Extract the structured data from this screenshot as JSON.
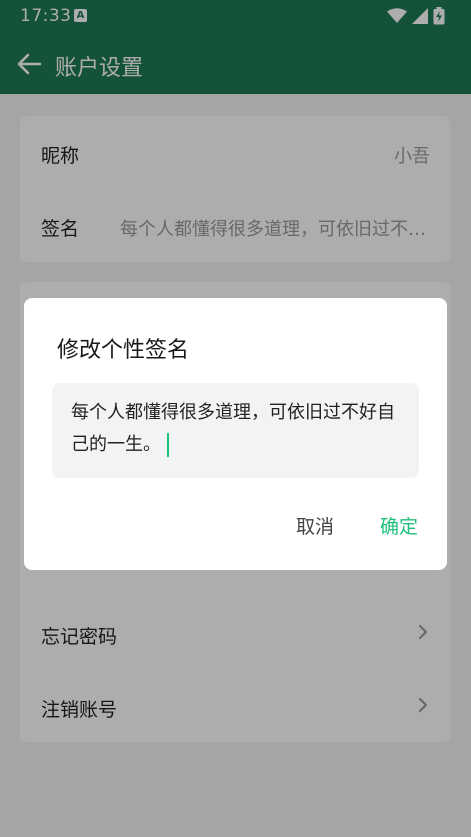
{
  "status_bar": {
    "time": "17:33",
    "notification_badge": "A",
    "icons": [
      "wifi-icon",
      "signal-icon",
      "battery-charging-icon"
    ]
  },
  "app_bar": {
    "title": "账户设置",
    "back_icon": "arrow-left-icon"
  },
  "profile_card": {
    "rows": [
      {
        "label": "昵称",
        "value": "小吾"
      },
      {
        "label": "签名",
        "value": "每个人都懂得很多道理，可依旧过不好自己的一生。"
      }
    ]
  },
  "account_card": {
    "rows": [
      {
        "label": "忘记密码",
        "icon": "chevron-right-icon"
      },
      {
        "label": "注销账号",
        "icon": "chevron-right-icon"
      }
    ]
  },
  "dialog": {
    "title": "修改个性签名",
    "input_value": "每个人都懂得很多道理，可依旧过不好自己的一生。",
    "cancel_label": "取消",
    "confirm_label": "确定"
  },
  "colors": {
    "primary": "#1e7a55",
    "accent": "#1fbf7a",
    "background": "#f3f4f6"
  }
}
